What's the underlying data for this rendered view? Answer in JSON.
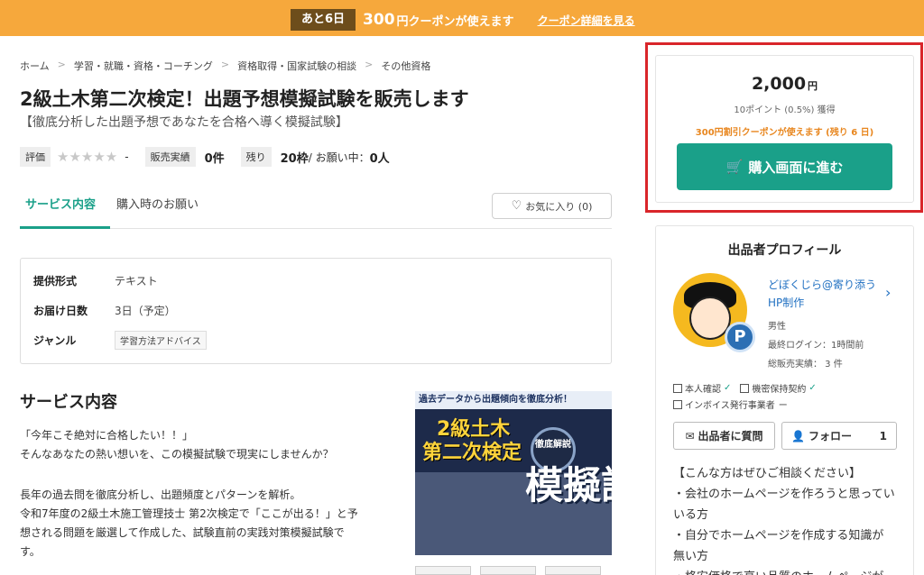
{
  "banner": {
    "days_left": "あと6日",
    "amount": "300",
    "amount_suffix": "円クーポンが使えます",
    "link": "クーポン詳細を見る",
    "color": "#f6a83c"
  },
  "breadcrumb": [
    "ホーム",
    "学習・就職・資格・コーチング",
    "資格取得・国家試験の相談",
    "その他資格"
  ],
  "title": "2級土木第二次検定！出題予想模擬試験を販売します",
  "subtitle": "【徹底分析した出題予想であなたを合格へ導く模擬試験】",
  "stats": {
    "rating_label": "評価",
    "rating_value": "-",
    "sales_label": "販売実績",
    "sales_value": "0件",
    "remain_label": "残り",
    "remain_value": "20枠",
    "request_text": " / お願い中：",
    "request_value": "0人"
  },
  "tabs": {
    "active": "サービス内容",
    "other": "購入時のお願い",
    "favorite": "お気に入り (0)"
  },
  "spec": {
    "rows": [
      {
        "label": "提供形式",
        "value": "テキスト"
      },
      {
        "label": "お届け日数",
        "value": "3日（予定）"
      },
      {
        "label": "ジャンル",
        "value": "学習方法アドバイス"
      }
    ]
  },
  "content": {
    "section_title": "サービス内容",
    "lines": [
      "「今年こそ絶対に合格したい！！」",
      "そんなあなたの熱い想いを、この模擬試験で現実にしませんか？",
      "",
      "長年の過去問を徹底分析し、出題頻度とパターンを解析。",
      "令和7年度の2級土木施工管理技士 第2次検定で「ここが出る！」と予",
      "想される問題を厳選して作成した、試験直前の実践対策模擬試験で",
      "す。"
    ]
  },
  "product_image": {
    "top": "過去データから出題傾向を徹底分析！",
    "head1": "2級土木",
    "head2": "第二次検定",
    "badge": "徹底解説",
    "main": "模擬試験"
  },
  "price_card": {
    "price": "2,000",
    "unit": "円",
    "points": "10ポイント (0.5%) 獲得",
    "coupon": "300円割引クーポンが使えます (残り 6 日)",
    "buy": "購入画面に進む",
    "accent": "#1aa089"
  },
  "profile": {
    "title": "出品者プロフィール",
    "name": "どぼくじら@寄り添うHP制作",
    "gender": "男性",
    "last_login": "最終ログイン：1時間前",
    "total_sales": "総販売実績： 3 件",
    "verifications": [
      "本人確認",
      "機密保持契約",
      "インボイス発行事業者"
    ],
    "invoice_value": "ー",
    "ask": "出品者に質問",
    "follow": "フォロー",
    "follow_count": "1",
    "description": [
      "【こんな方はぜひご相談ください】",
      "・会社のホームページを作ろうと思ってい",
      "いる方",
      "・自分でホームページを作成する知識が",
      "無い方",
      "・格安価格で高い品質のホームページが"
    ]
  },
  "icons": [
    "cart-icon",
    "heart-icon",
    "chevron-right-icon",
    "message-icon",
    "user-plus-icon",
    "id-card-icon",
    "lock-icon",
    "document-icon",
    "check-icon",
    "star-icon"
  ]
}
